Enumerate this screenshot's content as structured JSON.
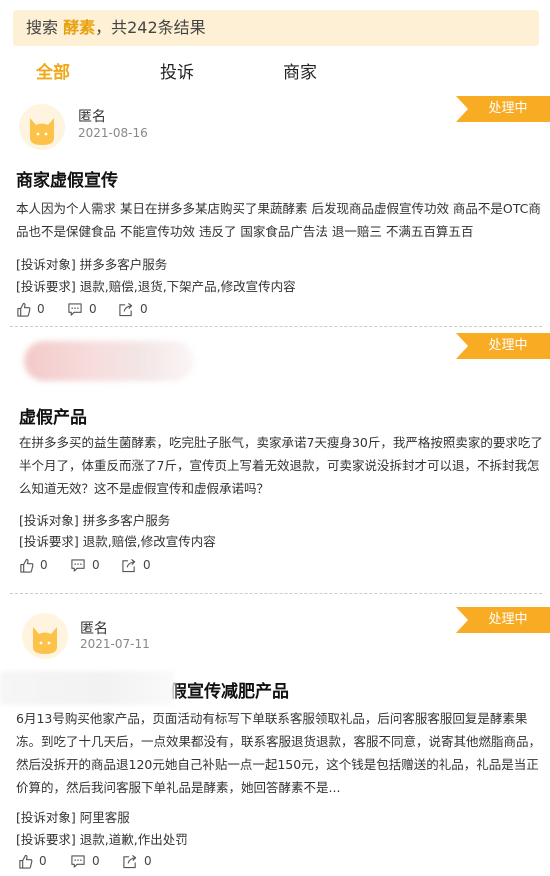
{
  "search": {
    "prefix": "搜索 ",
    "keyword": "酵素",
    "suffix": "，共242条结果"
  },
  "tabs": [
    {
      "label": "全部",
      "active": true
    },
    {
      "label": "投诉",
      "active": false
    },
    {
      "label": "商家",
      "active": false
    }
  ],
  "complaints": [
    {
      "user": "匿名",
      "date": "2021-08-16",
      "status": "处理中",
      "title": "商家虚假宣传",
      "content": "本人因为个人需求 某日在拼多多某店购买了果蔬酵素 后发现商品虚假宣传功效 商品不是OTC商品也不是保健食品 不能宣传功效 违反了 国家食品广告法 退一赔三 不满五百算五百",
      "target_label": "[投诉对象]",
      "target": "拼多多客户服务",
      "request_label": "[投诉要求]",
      "request": "退款,赔偿,退货,下架产品,修改宣传内容",
      "likes": "0",
      "comments": "0",
      "shares": "0"
    },
    {
      "user": "",
      "date": "",
      "status": "处理中",
      "title": "虚假产品",
      "content": "在拼多多买的益生菌酵素，吃完肚子胀气，卖家承诺7天瘦身30斤，我严格按照卖家的要求吃了半个月了，体重反而涨了7斤，宣传页上写着无效退款，可卖家说没拆封才可以退，不拆封我怎么知道无效？这不是虚假宣传和虚假承诺吗？",
      "target_label": "[投诉对象]",
      "target": "拼多多客户服务",
      "request_label": "[投诉要求]",
      "request": "退款,赔偿,修改宣传内容",
      "likes": "0",
      "comments": "0",
      "shares": "0"
    },
    {
      "user": "匿名",
      "date": "2021-07-11",
      "status": "处理中",
      "title": "虚假宣传减肥产品",
      "content": "6月13号购买他家产品，页面活动有标写下单联系客服领取礼品，后问客服客服回复是酵素果冻。到吃了十几天后，一点效果都没有，联系客服退货退款，客服不同意，说寄其他燃脂商品，然后没拆开的商品退120元她自己补贴一点一起150元，这个钱是包括赠送的礼品，礼品是当正价算的，然后我问客服下单礼品是酵素，她回答酵素不是...",
      "target_label": "[投诉对象]",
      "target": "阿里客服",
      "request_label": "[投诉要求]",
      "request": "退款,道歉,作出处罚",
      "likes": "0",
      "comments": "0",
      "shares": "0"
    }
  ],
  "colors": {
    "accent": "#f0a818",
    "status_bg": "#f7ac24",
    "search_bg": "#fdf0d4"
  },
  "icons": [
    "cat-avatar-icon",
    "thumbs-up-icon",
    "comment-icon",
    "share-icon"
  ]
}
